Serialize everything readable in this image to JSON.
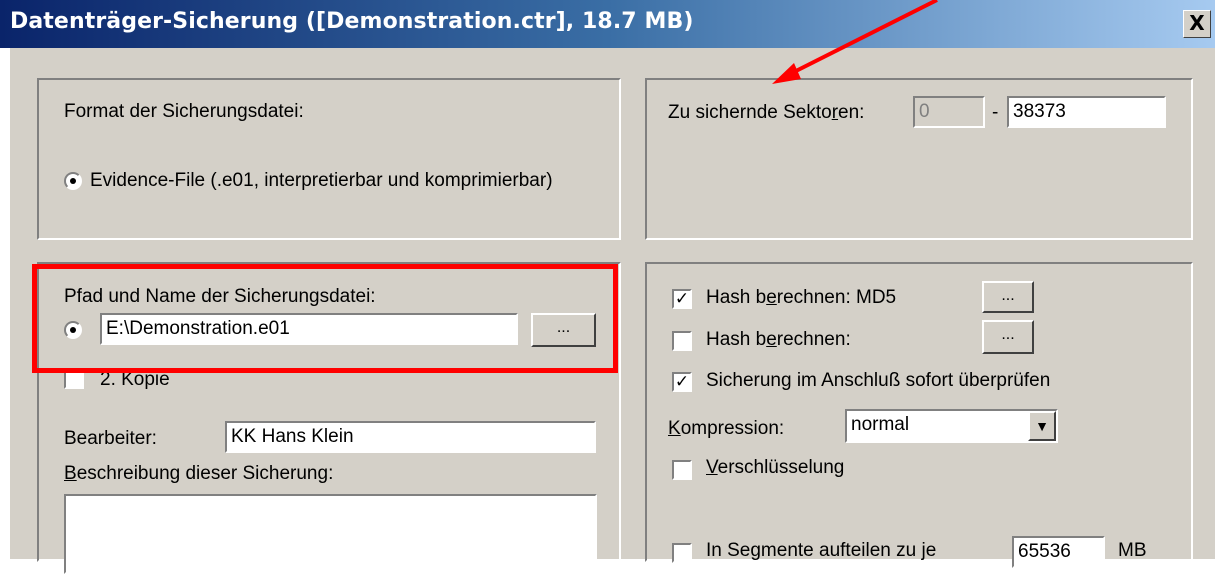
{
  "window": {
    "title": "Datenträger-Sicherung ([Demonstration.ctr], 18.7 MB)",
    "close_label": "X"
  },
  "format_group": {
    "label": "Format der Sicherungsdatei:",
    "option_label": "Evidence-File (.e01, interpretierbar und komprimierbar)",
    "option_selected": true
  },
  "sectors_group": {
    "label_pre": "Zu sichernde Sekto",
    "label_u": "r",
    "label_post": "en:",
    "from_value": "0",
    "separator": "-",
    "to_value": "38373"
  },
  "path_group": {
    "label": "Pfad und Name der Sicherungsdatei:",
    "path_value": "E:\\Demonstration.e01",
    "browse_label": "...",
    "second_copy_label": "2. Kopie",
    "second_copy_checked": false,
    "editor_label": "Bearbeiter:",
    "editor_value": "KK Hans Klein",
    "description_u": "B",
    "description_rest": "eschreibung dieser Sicherung:",
    "description_value": ""
  },
  "options_group": {
    "hash_md5_pre": "Hash b",
    "hash_md5_u": "e",
    "hash_md5_post": "rechnen: MD5",
    "hash_md5_checked": true,
    "hash_md5_button": "...",
    "hash2_pre": "Hash b",
    "hash2_u": "e",
    "hash2_post": "rechnen:",
    "hash2_checked": false,
    "hash2_button": "...",
    "verify_label": "Sicherung im Anschluß sofort überprüfen",
    "verify_checked": true,
    "compression_u": "K",
    "compression_rest": "ompression:",
    "compression_value": "normal",
    "encryption_u": "V",
    "encryption_rest": "erschlüsselung",
    "encryption_checked": false,
    "segments_label": "In Segmente aufteilen zu je",
    "segments_checked": false,
    "segments_value": "65536",
    "segments_unit": "MB"
  },
  "annotation": {
    "arrow_color": "#ff0000",
    "highlight_color": "#ff0000"
  }
}
